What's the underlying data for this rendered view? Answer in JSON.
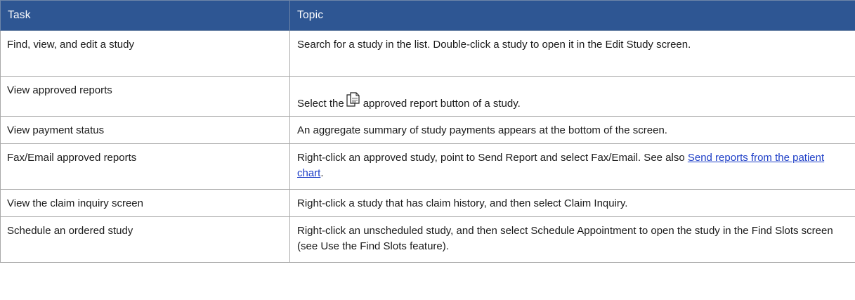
{
  "header": {
    "task": "Task",
    "topic": "Topic"
  },
  "rows": [
    {
      "task": "Find, view, and edit a study",
      "topic": "Search for a study in the list. Double-click a study to open it in the Edit Study screen."
    },
    {
      "task": "View approved reports",
      "topic_before_icon": "Select the",
      "icon": "approved-report-icon",
      "topic_after_icon": "approved report button of a study."
    },
    {
      "task": "View payment status",
      "topic": "An aggregate summary of study payments appears at the bottom of the screen."
    },
    {
      "task": "Fax/Email approved reports",
      "topic": "Right-click an approved study, point to Send Report and select Fax/Email. See also",
      "link": "Send reports from the patient chart",
      "after_link": "."
    },
    {
      "task": "View the claim inquiry screen",
      "topic": "Right-click a study that has claim history, and then select Claim Inquiry."
    },
    {
      "task": "Schedule an ordered study",
      "topic": "Right-click an unscheduled study, and then select Schedule Appointment to open the study in the Find Slots screen (see Use the Find Slots feature)."
    }
  ],
  "colors": {
    "header_bg": "#2e5693",
    "header_text": "#ffffff",
    "border": "#a9a9a9",
    "link": "#1d3ec7"
  }
}
